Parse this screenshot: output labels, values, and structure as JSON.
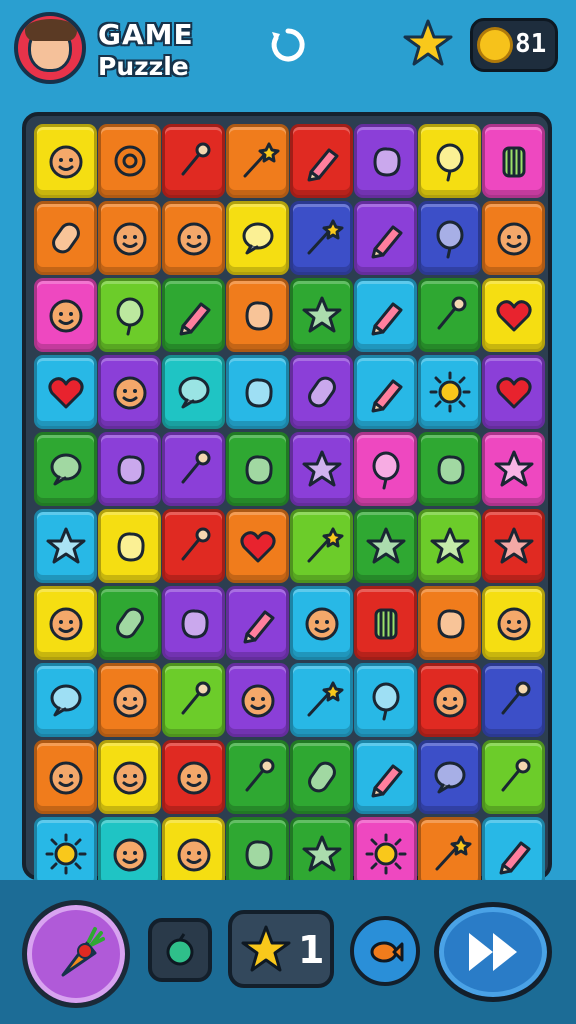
{
  "header": {
    "title_line1": "GAME",
    "title_line2": "Puzzle",
    "coins": "81"
  },
  "icons": {
    "avatar": "player-avatar",
    "restart": "restart-icon",
    "star": "star-icon",
    "coin": "coin-icon"
  },
  "board": {
    "columns": 8,
    "rows": [
      [
        {
          "c": "#f5de12",
          "i": "face"
        },
        {
          "c": "#f07c1c",
          "i": "target"
        },
        {
          "c": "#e02a22",
          "i": "wrench"
        },
        {
          "c": "#f07c1c",
          "i": "wand"
        },
        {
          "c": "#e02a22",
          "i": "pencil"
        },
        {
          "c": "#8b3fd8",
          "i": "blob"
        },
        {
          "c": "#f5de12",
          "i": "balloon"
        },
        {
          "c": "#ee48c0",
          "i": "jar"
        }
      ],
      [
        {
          "c": "#f07c1c",
          "i": "capsule"
        },
        {
          "c": "#f07c1c",
          "i": "face"
        },
        {
          "c": "#f07c1c",
          "i": "face"
        },
        {
          "c": "#f5de12",
          "i": "bubble"
        },
        {
          "c": "#3c4fc8",
          "i": "wand"
        },
        {
          "c": "#8b3fd8",
          "i": "pencil"
        },
        {
          "c": "#3c4fc8",
          "i": "balloon"
        },
        {
          "c": "#f07c1c",
          "i": "face"
        }
      ],
      [
        {
          "c": "#ee48c0",
          "i": "face"
        },
        {
          "c": "#6ccc2a",
          "i": "balloon"
        },
        {
          "c": "#2fa832",
          "i": "pencil"
        },
        {
          "c": "#f07c1c",
          "i": "blob"
        },
        {
          "c": "#2fa832",
          "i": "star"
        },
        {
          "c": "#28b8e6",
          "i": "pencil"
        },
        {
          "c": "#2fa832",
          "i": "wrench"
        },
        {
          "c": "#f5de12",
          "i": "heart"
        }
      ],
      [
        {
          "c": "#28b8e6",
          "i": "heart"
        },
        {
          "c": "#8b3fd8",
          "i": "face"
        },
        {
          "c": "#1fc4c4",
          "i": "bubble"
        },
        {
          "c": "#28b8e6",
          "i": "blob"
        },
        {
          "c": "#8b3fd8",
          "i": "capsule"
        },
        {
          "c": "#28b8e6",
          "i": "pencil"
        },
        {
          "c": "#28b8e6",
          "i": "sun"
        },
        {
          "c": "#8b3fd8",
          "i": "heart"
        }
      ],
      [
        {
          "c": "#2fa832",
          "i": "bubble"
        },
        {
          "c": "#8b3fd8",
          "i": "blob"
        },
        {
          "c": "#8b3fd8",
          "i": "wrench"
        },
        {
          "c": "#2fa832",
          "i": "blob"
        },
        {
          "c": "#8b3fd8",
          "i": "star"
        },
        {
          "c": "#ee48c0",
          "i": "balloon"
        },
        {
          "c": "#2fa832",
          "i": "blob"
        },
        {
          "c": "#ee48c0",
          "i": "star"
        }
      ],
      [
        {
          "c": "#28b8e6",
          "i": "star"
        },
        {
          "c": "#f5de12",
          "i": "blob"
        },
        {
          "c": "#e02a22",
          "i": "wrench"
        },
        {
          "c": "#f07c1c",
          "i": "heart"
        },
        {
          "c": "#6ccc2a",
          "i": "wand"
        },
        {
          "c": "#2fa832",
          "i": "star"
        },
        {
          "c": "#6ccc2a",
          "i": "star"
        },
        {
          "c": "#e02a22",
          "i": "star"
        }
      ],
      [
        {
          "c": "#f5de12",
          "i": "face"
        },
        {
          "c": "#2fa832",
          "i": "capsule"
        },
        {
          "c": "#8b3fd8",
          "i": "blob"
        },
        {
          "c": "#8b3fd8",
          "i": "pencil"
        },
        {
          "c": "#28b8e6",
          "i": "face"
        },
        {
          "c": "#e02a22",
          "i": "jar"
        },
        {
          "c": "#f07c1c",
          "i": "blob"
        },
        {
          "c": "#f5de12",
          "i": "face"
        }
      ],
      [
        {
          "c": "#28b8e6",
          "i": "bubble"
        },
        {
          "c": "#f07c1c",
          "i": "face"
        },
        {
          "c": "#6ccc2a",
          "i": "wrench"
        },
        {
          "c": "#8b3fd8",
          "i": "face"
        },
        {
          "c": "#28b8e6",
          "i": "wand"
        },
        {
          "c": "#28b8e6",
          "i": "balloon"
        },
        {
          "c": "#e02a22",
          "i": "face"
        },
        {
          "c": "#3c4fc8",
          "i": "wrench"
        }
      ],
      [
        {
          "c": "#f07c1c",
          "i": "face"
        },
        {
          "c": "#f5de12",
          "i": "face"
        },
        {
          "c": "#e02a22",
          "i": "face"
        },
        {
          "c": "#2fa832",
          "i": "wrench"
        },
        {
          "c": "#2fa832",
          "i": "capsule"
        },
        {
          "c": "#28b8e6",
          "i": "pencil"
        },
        {
          "c": "#3c4fc8",
          "i": "bubble"
        },
        {
          "c": "#6ccc2a",
          "i": "wrench"
        }
      ],
      [
        {
          "c": "#28b8e6",
          "i": "sun"
        },
        {
          "c": "#1fc4c4",
          "i": "face"
        },
        {
          "c": "#f5de12",
          "i": "face"
        },
        {
          "c": "#2fa832",
          "i": "blob"
        },
        {
          "c": "#2fa832",
          "i": "star"
        },
        {
          "c": "#ee48c0",
          "i": "sun"
        },
        {
          "c": "#f07c1c",
          "i": "wand"
        },
        {
          "c": "#28b8e6",
          "i": "pencil"
        }
      ]
    ]
  },
  "bottom_bar": {
    "booster_icon": "carrot-icon",
    "small_icon": "apple-icon",
    "star_count": "1",
    "round_icon": "fish-icon",
    "next_icon": "fast-forward-icon"
  }
}
